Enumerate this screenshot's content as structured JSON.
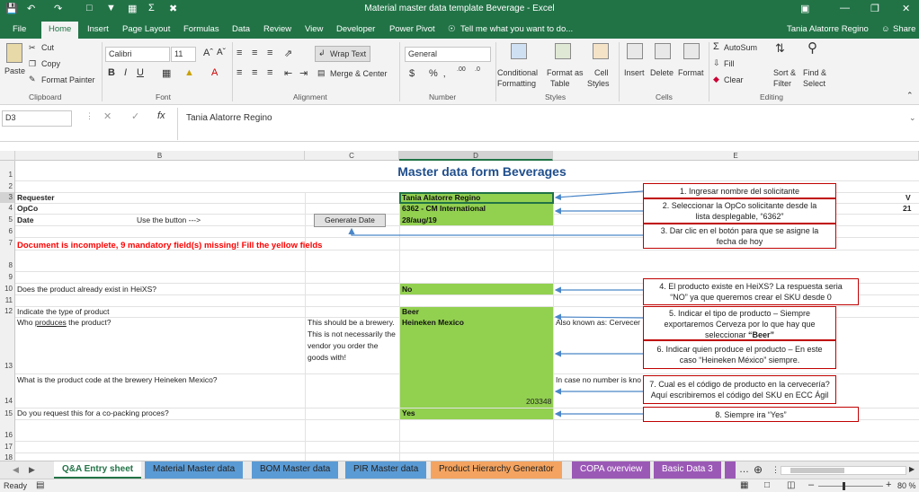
{
  "window": {
    "title": "Material master data template Beverage - Excel",
    "user": "Tania Alatorre Regino",
    "share": "Share"
  },
  "tabs": [
    "File",
    "Home",
    "Insert",
    "Page Layout",
    "Formulas",
    "Data",
    "Review",
    "View",
    "Developer",
    "Power Pivot"
  ],
  "tellme": "Tell me what you want to do...",
  "ribbon": {
    "clipboard": {
      "paste": "Paste",
      "cut": "Cut",
      "copy": "Copy",
      "format_painter": "Format Painter",
      "label": "Clipboard"
    },
    "font": {
      "name": "Calibri",
      "size": "11",
      "label": "Font"
    },
    "alignment": {
      "wrap": "Wrap Text",
      "merge": "Merge & Center",
      "label": "Alignment"
    },
    "number": {
      "format": "General",
      "label": "Number"
    },
    "styles": {
      "cond1": "Conditional",
      "cond2": "Formatting",
      "fmt1": "Format as",
      "fmt2": "Table",
      "cell1": "Cell",
      "cell2": "Styles",
      "label": "Styles"
    },
    "cells": {
      "insert": "Insert",
      "delete": "Delete",
      "format": "Format",
      "label": "Cells"
    },
    "editing": {
      "autosum": "AutoSum",
      "fill": "Fill",
      "clear": "Clear",
      "sort1": "Sort &",
      "sort2": "Filter",
      "find1": "Find &",
      "find2": "Select",
      "label": "Editing"
    }
  },
  "formula_bar": {
    "namebox": "D3",
    "fx": "fx",
    "value": "Tania Alatorre Regino"
  },
  "columns": [
    "B",
    "C",
    "D",
    "E"
  ],
  "rows": [
    "1",
    "2",
    "3",
    "4",
    "5",
    "6",
    "7",
    "8",
    "9",
    "10",
    "11",
    "12",
    "13",
    "14",
    "15",
    "16",
    "17",
    "18"
  ],
  "sheet": {
    "title": "Master data form Beverages",
    "requester": "Requester",
    "opco": "OpCo",
    "date": "Date",
    "use_button": "Use the button --->",
    "generate_date": "Generate Date",
    "requester_val": "Tania Alatorre Regino",
    "opco_val": "6362 - CM International",
    "date_val": "28/aug/19",
    "warning": "Document is incomplete, 9 mandatory field(s) missing! Fill the yellow fields",
    "q10": "Does the product already exist in HeiXS?",
    "a10": "No",
    "q12": "Indicate the type of product",
    "a12": "Beer",
    "q13a": "Who ",
    "q13u": "produces",
    "q13b": " the product?",
    "c13": [
      "This should be a brewery.",
      "This is not necessarily the",
      "vendor you order the",
      "goods with!"
    ],
    "a13": "Heineken Mexico",
    "e13": "Also known as: Cervecer",
    "q14": "What is the product code at the brewery Heineken Mexico?",
    "e14": "In case no number is kno",
    "a14": "203348",
    "q15": "Do you request this for a co-packing proces?",
    "a15": "Yes",
    "edge_top": "V",
    "edge_bot": "21"
  },
  "callouts": [
    {
      "plain": "1. Ingresar nombre del solicitante"
    },
    {
      "l1": "2. Seleccionar la OpCo solicitante desde la",
      "l2": "lista desplegable, “6362”"
    },
    {
      "l1": "3. Dar clic en el botón para que se asigne la",
      "l2": "fecha de hoy"
    },
    {
      "l1": "4. El producto existe en HeiXS? La respuesta seria",
      "l2": "“NO” ya que queremos crear el SKU desde 0"
    },
    {
      "l1": "5. Indicar el tipo de producto – Siempre",
      "l2": "exportaremos Cerveza por lo que hay que",
      "l3a": "seleccionar ",
      "l3b": "“Beer”"
    },
    {
      "l1": "6. Indicar quien produce el producto – En este",
      "l2": "caso “Heineken México” siempre."
    },
    {
      "l1": "7. Cual es el código de producto en la cervecería?",
      "l2": "Aquí escribiremos el código del SKU en ECC Ágil"
    },
    {
      "plain": "8. Siempre ira “Yes”"
    }
  ],
  "sheet_tabs": [
    "Q&A Entry sheet",
    "Material Master data",
    "BOM Master data",
    "PIR Master data",
    "Product Hierarchy Generator",
    "COPA overview",
    "Basic Data 3"
  ],
  "status": {
    "ready": "Ready",
    "zoom": "80 %"
  },
  "colors": {
    "excel_green": "#217346",
    "cell_green": "#92d050",
    "callout_red": "#c00000",
    "title_blue": "#1f4e8c",
    "warning_red": "#ff0000",
    "arrow_blue": "#4a86c8"
  }
}
